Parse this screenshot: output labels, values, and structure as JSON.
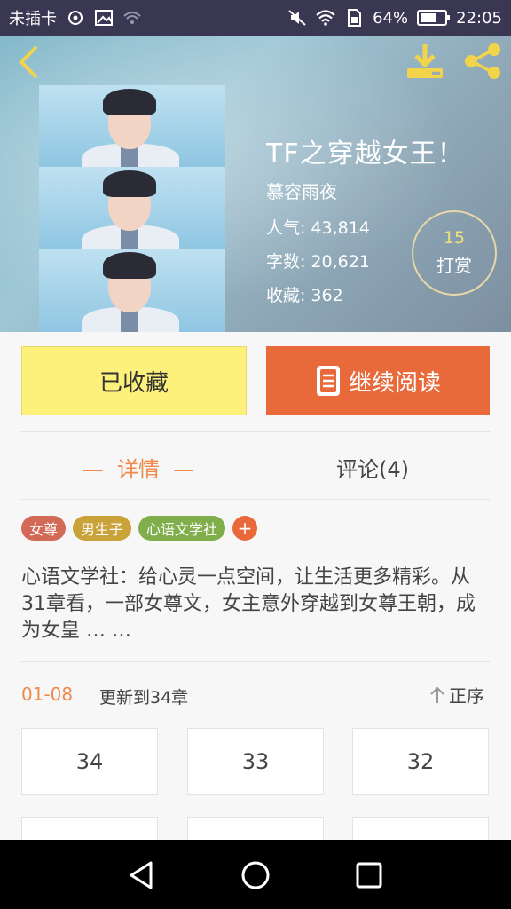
{
  "status_bar": {
    "carrier": "未插卡",
    "battery_percent": "64%",
    "battery_level": 0.64,
    "time": "22:05"
  },
  "book": {
    "title": "TF之穿越女王！",
    "author": "慕容雨夜",
    "popularity_label": "人气:",
    "popularity": "43,814",
    "word_count_label": "字数:",
    "word_count": "20,621",
    "favorites_label": "收藏:",
    "favorites": "362"
  },
  "tip": {
    "count": "15",
    "label": "打赏"
  },
  "actions": {
    "favorited_label": "已收藏",
    "continue_label": "继续阅读"
  },
  "tabs": {
    "detail_label": "—  详情  —",
    "comments_label": "评论(4)"
  },
  "tags": [
    {
      "label": "女尊",
      "color": "#d26a57"
    },
    {
      "label": "男生子",
      "color": "#c9a23a"
    },
    {
      "label": "心语文学社",
      "color": "#7fae4a"
    }
  ],
  "tag_add": "+",
  "description": "心语文学社：给心灵一点空间，让生活更多精彩。从31章看，一部女尊文，女主意外穿越到女尊王朝，成为女皇 … …",
  "chapters": {
    "range": "01-08",
    "update_text": "更新到34章",
    "sort_label": "正序",
    "items": [
      "34",
      "33",
      "32"
    ]
  },
  "colors": {
    "accent_orange": "#e8693a",
    "favorite_yellow": "#fdf07b",
    "status_bar": "#3a3753"
  }
}
